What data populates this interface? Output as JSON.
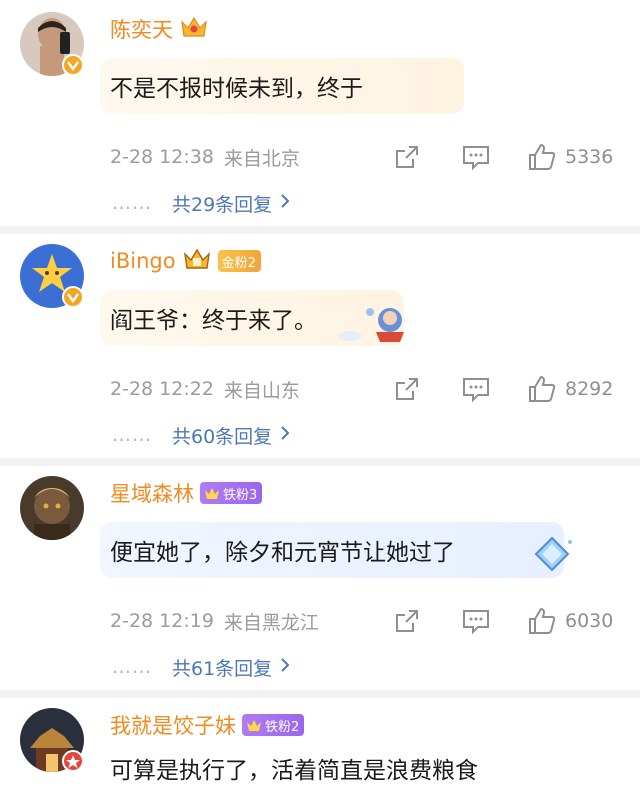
{
  "comments": [
    {
      "username": "陈奕天",
      "text": "不是不报时候未到，终于",
      "time": "2-28 12:38",
      "location": "来自北京",
      "likes": "5336",
      "replies_dots": "……",
      "replies": "共29条回复",
      "verify_color": "#f5a623"
    },
    {
      "username": "iBingo",
      "fan_badge": "金粉2",
      "text": "阎王爷：终于来了。",
      "time": "2-28 12:22",
      "location": "来自山东",
      "likes": "8292",
      "replies_dots": "……",
      "replies": "共60条回复",
      "verify_color": "#f5a623"
    },
    {
      "username": "星域森林",
      "fan_badge": "铁粉3",
      "text": "便宜她了，除夕和元宵节让她过了",
      "time": "2-28 12:19",
      "location": "来自黑龙江",
      "likes": "6030",
      "replies_dots": "……",
      "replies": "共61条回复"
    },
    {
      "username": "我就是饺子妹",
      "fan_badge": "铁粉2",
      "text": "可算是执行了，活着简直是浪费粮食",
      "verify_color": "#e8453c"
    }
  ],
  "icons": {
    "share": "share-icon",
    "comment": "comment-icon",
    "like": "thumbs-up-icon",
    "crown": "crown-icon",
    "chevron": "chevron-right-icon"
  },
  "colors": {
    "username": "#f28a1f",
    "reply_link": "#4d78b5",
    "meta": "#9b9b9b",
    "gold_badge": "#f2a43b",
    "iron_badge": "#9a66ee"
  }
}
